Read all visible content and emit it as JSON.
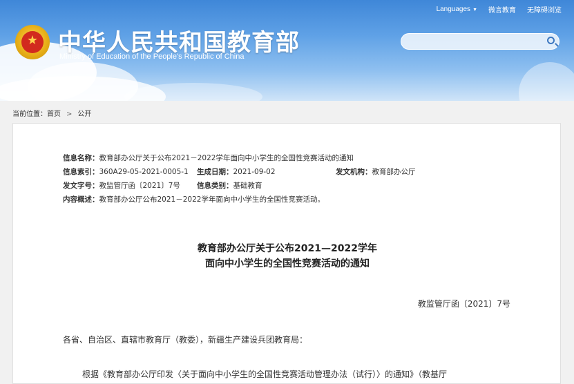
{
  "header": {
    "languages": "Languages",
    "weibo": "微言教育",
    "accessibility": "无障碍浏览",
    "title_cn": "中华人民共和国教育部",
    "title_en": "Ministry of Education of the People's Republic of China",
    "search_placeholder": ""
  },
  "breadcrumb": {
    "label": "当前位置：",
    "home": "首页",
    "current": "公开"
  },
  "meta": {
    "name_label": "信息名称：",
    "name_value": "教育部办公厅关于公布2021－2022学年面向中小学生的全国性竞赛活动的通知",
    "index_label": "信息索引：",
    "index_value": "360A29-05-2021-0005-1",
    "date_label": "生成日期：",
    "date_value": "2021-09-02",
    "org_label": "发文机构：",
    "org_value": "教育部办公厅",
    "docno_label": "发文字号：",
    "docno_value": "教监管厅函〔2021〕7号",
    "category_label": "信息类别：",
    "category_value": "基础教育",
    "summary_label": "内容概述：",
    "summary_value": "教育部办公厅公布2021－2022学年面向中小学生的全国性竞赛活动。"
  },
  "document": {
    "title_line1": "教育部办公厅关于公布2021—2022学年",
    "title_line2": "面向中小学生的全国性竞赛活动的通知",
    "doc_number": "教监管厅函〔2021〕7号",
    "addressee": "各省、自治区、直辖市教育厅（教委），新疆生产建设兵团教育局：",
    "body_first_line": "根据《教育部办公厅印发〈关于面向中小学生的全国性竞赛活动管理办法（试行）〉的通知》（教基厅"
  }
}
